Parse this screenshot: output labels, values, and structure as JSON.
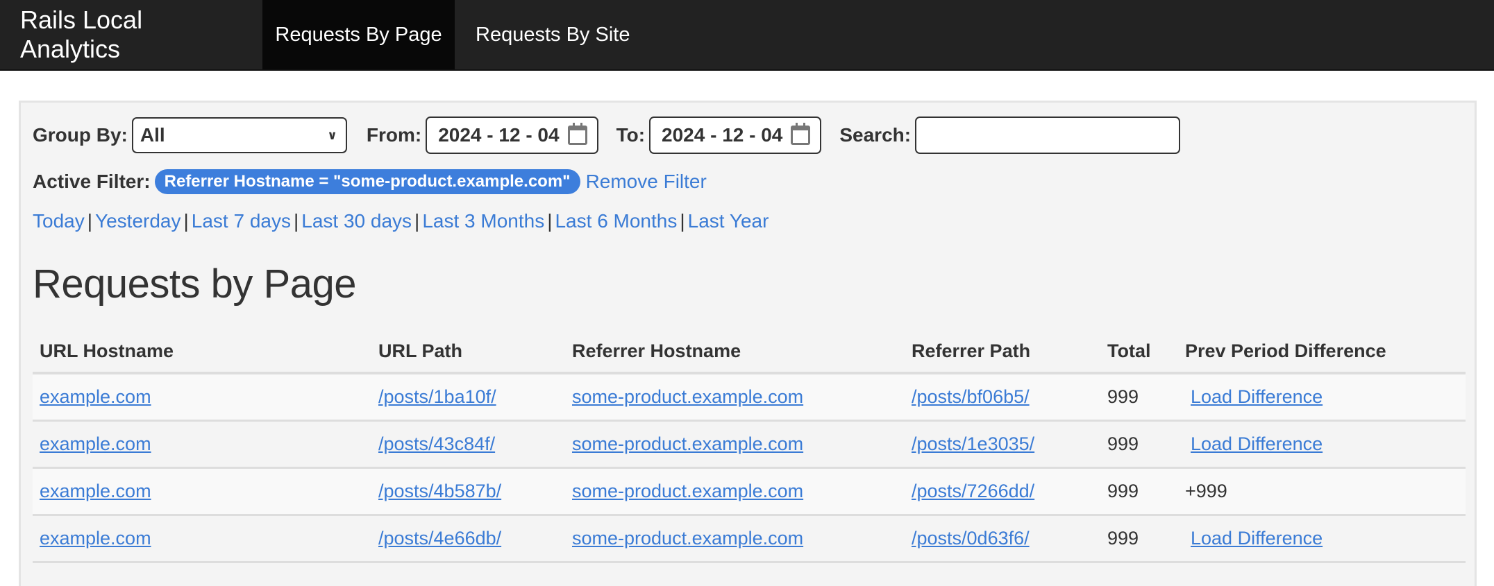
{
  "navbar": {
    "brand": "Rails Local Analytics",
    "items": [
      {
        "label": "Requests By Page",
        "active": true
      },
      {
        "label": "Requests By Site",
        "active": false
      }
    ]
  },
  "filters": {
    "group_by_label": "Group By:",
    "group_by_value": "All",
    "from_label": "From:",
    "from_value": "2024 - 12 - 04",
    "to_label": "To:",
    "to_value": "2024 - 12 - 04",
    "search_label": "Search:",
    "search_value": ""
  },
  "active_filter": {
    "label": "Active Filter:",
    "badge": "Referrer Hostname = \"some-product.example.com\"",
    "remove_label": "Remove Filter"
  },
  "date_ranges": [
    "Today",
    "Yesterday",
    "Last 7 days",
    "Last 30 days",
    "Last 3 Months",
    "Last 6 Months",
    "Last Year"
  ],
  "page_title": "Requests by Page",
  "table": {
    "columns": [
      "URL Hostname",
      "URL Path",
      "Referrer Hostname",
      "Referrer Path",
      "Total",
      "Prev Period Difference"
    ],
    "rows": [
      {
        "url_hostname": "example.com",
        "url_path": "/posts/1ba10f/",
        "referrer_hostname": "some-product.example.com",
        "referrer_path": "/posts/bf06b5/",
        "total": "999",
        "diff": "Load Difference",
        "diff_is_link": true
      },
      {
        "url_hostname": "example.com",
        "url_path": "/posts/43c84f/",
        "referrer_hostname": "some-product.example.com",
        "referrer_path": "/posts/1e3035/",
        "total": "999",
        "diff": "Load Difference",
        "diff_is_link": true
      },
      {
        "url_hostname": "example.com",
        "url_path": "/posts/4b587b/",
        "referrer_hostname": "some-product.example.com",
        "referrer_path": "/posts/7266dd/",
        "total": "999",
        "diff": "+999",
        "diff_is_link": false
      },
      {
        "url_hostname": "example.com",
        "url_path": "/posts/4e66db/",
        "referrer_hostname": "some-product.example.com",
        "referrer_path": "/posts/0d63f6/",
        "total": "999",
        "diff": "Load Difference",
        "diff_is_link": true
      }
    ]
  },
  "colors": {
    "navbar_bg": "#222222",
    "nav_active_bg": "#080808",
    "link": "#3a7bd5",
    "badge_bg": "#3d7edc",
    "panel_bg": "#f4f4f4"
  }
}
